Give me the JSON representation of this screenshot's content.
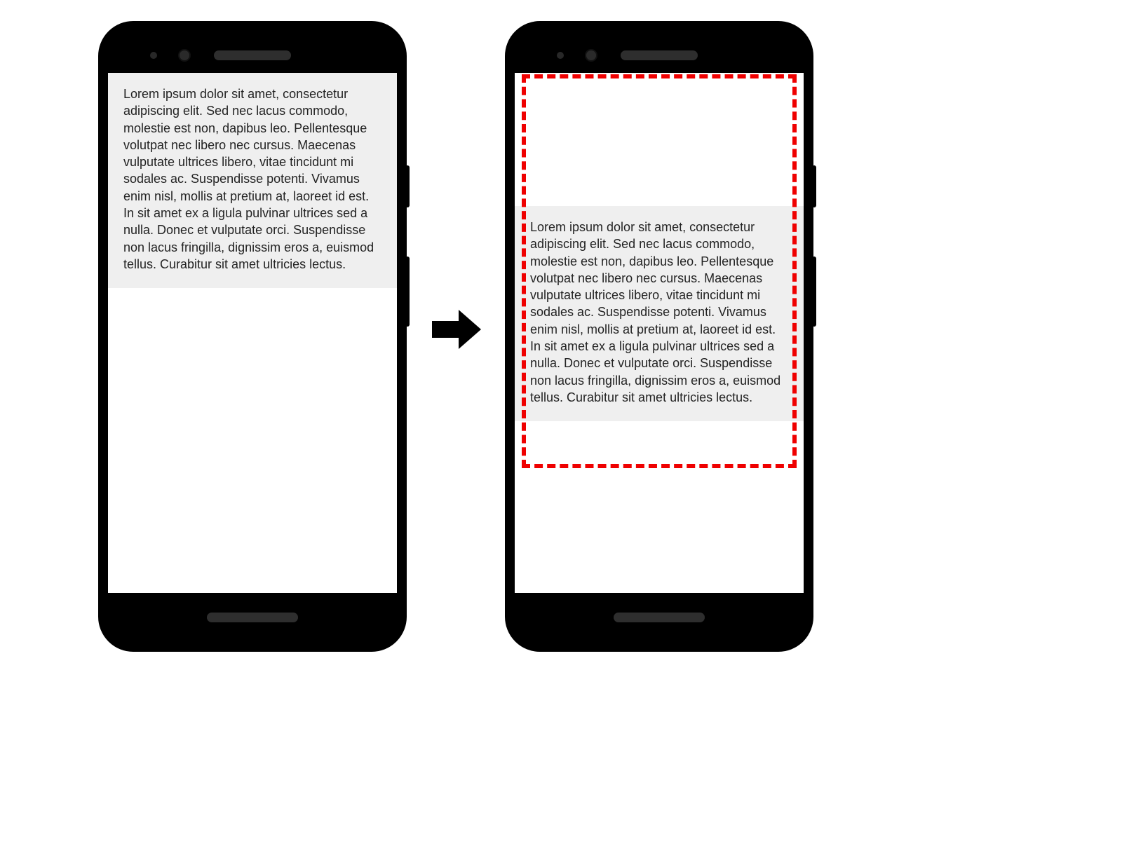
{
  "lorem_text": "Lorem ipsum dolor sit amet, consectetur adipiscing elit. Sed nec lacus commodo, molestie est non, dapibus leo. Pellentesque volutpat nec libero nec cursus. Maecenas vulputate ultrices libero, vitae tincidunt mi sodales ac. Suspendisse potenti. Vivamus enim nisl, mollis at pretium at, laoreet id est. In sit amet ex a ligula pulvinar ultrices sed a nulla. Donec et vulpuate orci. Suspendisse non lacus fringilla, dignissim eros a, euismod tellus. Curabitur sit amet ultricies lectus.",
  "lorem_text_full": "Lorem ipsum dolor sit amet, consectetur adipiscing elit. Sed nec lacus commodo, molestie est non, dapibus leo. Pellentesque volutpat nec libero nec cursus. Maecenas vulputate ultrices libero, vitae tincidunt mi sodales ac. Suspendisse potenti. Vivamus enim nisl, mollis at pretium at, laoreet id est. In sit amet ex a ligula pulvinar ultrices sed a nulla. Donec et vulputate orci. Suspendisse non lacus fringilla, dignissim eros a, euismod tellus. Curabitur sit amet ultricies lectus."
}
